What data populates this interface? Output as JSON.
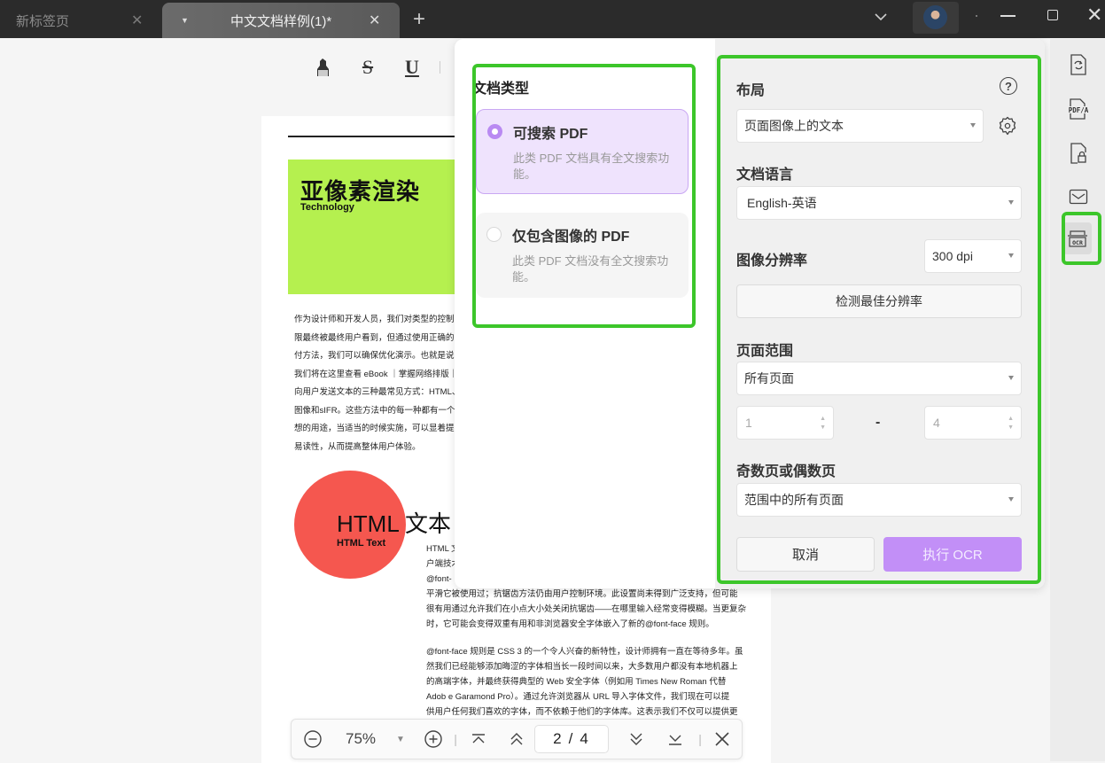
{
  "tabs": [
    {
      "label": "新标签页",
      "active": false
    },
    {
      "label": "中文文档样例(1)*",
      "active": true
    }
  ],
  "titlebar": {
    "tab_close_glyph": "✕",
    "add_tab_glyph": "+",
    "window_close_glyph": "✕"
  },
  "format_toolbar": {
    "highlight": "highlighter-icon",
    "strikethrough": "S",
    "underline": "U"
  },
  "document": {
    "banner_title": "亚像素渲染",
    "banner_subtitle": "Technology",
    "paragraph1": [
      "作为设计师和开发人员，我们对类型的控制有",
      "限最终被最终用户看到，但通过使用正确的交",
      "付方法，我们可以确保优化演示。也就是说，",
      "我们将在这里查看 eBook ｜掌握网络排版｜",
      "向用户发送文本的三种最常见方式：HTML、",
      "图像和sIFR。这些方法中的每一种都有一个理",
      "想的用途，当适当的时候实施，可以显着提高",
      "易读性，从而提高整体用户体验。"
    ],
    "circle_title": "HTML 文本",
    "circle_subtitle": "HTML Text",
    "paragraph2": [
      "HTML 文",
      "户端技术",
      "@font-",
      "平滑它被使用过；抗锯齿方法仍由用户控制环境。此设置尚未得到广泛支持，但可能",
      "很有用通过允许我们在小点大小处关闭抗锯齿——在哪里输入经常变得模糊。当更复杂",
      "时，它可能会变得双重有用和非浏览器安全字体嵌入了新的@font-face 规则。"
    ],
    "paragraph3": [
      "@font-face 规则是 CSS 3 的一个令人兴奋的新特性，设计师拥有一直在等待多年。虽",
      "然我们已经能够添加晦涩的字体相当长一段时间以来，大多数用户都没有本地机器上",
      "的高端字体，并最终获得典型的 Web 安全字体（例如用 Times New Roman 代替",
      "Adob    e Garamond Pro）。通过允许浏览器从 URL 导入字体文件，我们现在可以提",
      "供用户任何我们喜欢的字体，而不依赖于他们的字体库。这表示我们不仅可以提供更"
    ]
  },
  "nav_toolbar": {
    "zoom_value": "75%",
    "page_current": "2",
    "page_separator": "/",
    "page_total": "4"
  },
  "ocr_dialog": {
    "doc_type_title": "文档类型",
    "doc_types": [
      {
        "label": "可搜索 PDF",
        "desc": "此类 PDF 文档具有全文搜索功能。",
        "selected": true
      },
      {
        "label": "仅包含图像的 PDF",
        "desc": "此类 PDF 文档没有全文搜索功能。",
        "selected": false
      }
    ],
    "layout_label": "布局",
    "layout_value": "页面图像上的文本",
    "language_label": "文档语言",
    "language_value": "English-英语",
    "resolution_label": "图像分辨率",
    "resolution_value": "300 dpi",
    "detect_button": "检测最佳分辨率",
    "page_range_label": "页面范围",
    "page_range_value": "所有页面",
    "range_from": "1",
    "range_dash": "-",
    "range_to": "4",
    "odd_even_label": "奇数页或偶数页",
    "odd_even_value": "范围中的所有页面",
    "cancel_button": "取消",
    "run_button": "执行 OCR",
    "help_glyph": "?"
  },
  "right_sidebar": {
    "items": [
      "convert-icon",
      "pdfa-icon",
      "protect-icon",
      "mail-icon",
      "ocr-icon"
    ],
    "ocr_label": "OCR",
    "pdfa_label": "PDF/A"
  },
  "colors": {
    "accent_purple": "#c28ff7",
    "selected_card_bg": "#efe3fd",
    "highlight_green": "#3cc62a",
    "banner_green": "#b5f04f",
    "circle_red": "#f5574f"
  }
}
